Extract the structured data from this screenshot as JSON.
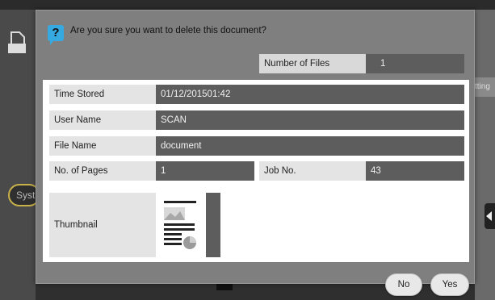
{
  "background": {
    "system_tab_label": "Syst",
    "right_tab_label": "tting"
  },
  "dialog": {
    "icon": "question-icon",
    "message": "Are you sure you want to delete this document?",
    "number_of_files": {
      "label": "Number of Files",
      "value": "1"
    },
    "fields": {
      "time_stored": {
        "label": "Time Stored",
        "value": "01/12/201501:42"
      },
      "user_name": {
        "label": "User Name",
        "value": "SCAN"
      },
      "file_name": {
        "label": "File Name",
        "value": "document"
      },
      "no_of_pages": {
        "label": "No. of Pages",
        "value": "1"
      },
      "job_no": {
        "label": "Job No.",
        "value": "43"
      }
    },
    "thumbnail": {
      "label": "Thumbnail"
    },
    "buttons": {
      "no": "No",
      "yes": "Yes"
    }
  },
  "colors": {
    "dialog_bg": "#7f7f7f",
    "value_bg": "#5d5d5d",
    "label_bg": "#e4e4e4",
    "icon_accent": "#36a9e1",
    "sys_border": "#c9b14a"
  }
}
